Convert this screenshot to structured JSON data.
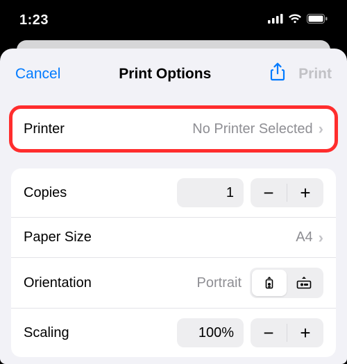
{
  "statusbar": {
    "time": "1:23"
  },
  "nav": {
    "cancel": "Cancel",
    "title": "Print Options",
    "print": "Print"
  },
  "printer": {
    "label": "Printer",
    "value": "No Printer Selected"
  },
  "copies": {
    "label": "Copies",
    "value": "1"
  },
  "paper": {
    "label": "Paper Size",
    "value": "A4"
  },
  "orientation": {
    "label": "Orientation",
    "value": "Portrait"
  },
  "scaling": {
    "label": "Scaling",
    "value": "100%"
  }
}
